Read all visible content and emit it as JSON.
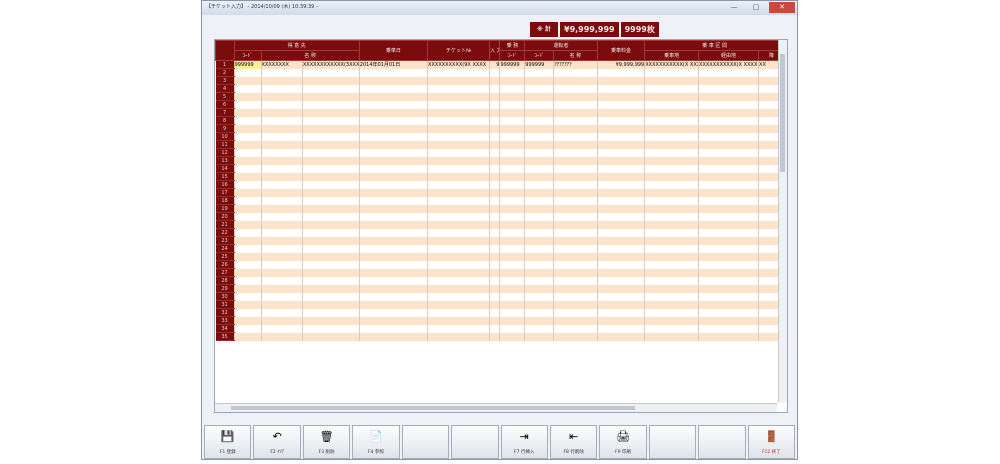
{
  "window": {
    "title": "【チケット入力】 - 2014/10/09 (木) 10:39:39 -",
    "controls": {
      "minimize": "—",
      "maximize": "□",
      "close": "✕"
    }
  },
  "totals": {
    "label": "※ 計",
    "amount": "¥9,999,999",
    "count": "9999枚"
  },
  "grid": {
    "group_headers": [
      "得 意 先",
      "乗車日",
      "チケット№",
      "入 力",
      "乗 務",
      "運転者",
      "乗車料金",
      "乗 車 区 間"
    ],
    "sub_headers": [
      "ｺｰﾄﾞ",
      "名 称",
      "ｺｰﾄﾞ",
      "ｺｰﾄﾞ",
      "名 称",
      "乗車地",
      "経由地",
      "降"
    ],
    "first_row": [
      "999999",
      "XXXXXXXX",
      "XXXXXXXXXXXX(3XXX",
      "2014年01月01日",
      "XXXXXXXXXX(9X XXXX",
      "9",
      "999999",
      "999999",
      "ｱｱｱｱｱｱｱ",
      "¥9,999,999",
      "XXXXXXXXXXX(X XXXX",
      "XXXXXXXXXXX(X XXXX",
      "XX"
    ],
    "row_count": 35
  },
  "toolbar": {
    "buttons": [
      {
        "key": "f1",
        "label": "F1 登録",
        "icon": "floppy-disk-icon",
        "glyph": "💾"
      },
      {
        "key": "f2",
        "label": "F2 ｸﾘｱ",
        "icon": "undo-arrow-icon",
        "glyph": "↶"
      },
      {
        "key": "f3",
        "label": "F3 削除",
        "icon": "trash-can-icon",
        "glyph": "🗑"
      },
      {
        "key": "f4",
        "label": "F4 参照",
        "icon": "document-icon",
        "glyph": "📄"
      },
      {
        "key": "f5",
        "label": "",
        "icon": "",
        "glyph": ""
      },
      {
        "key": "f6",
        "label": "",
        "icon": "",
        "glyph": ""
      },
      {
        "key": "f7",
        "label": "F7 行挿入",
        "icon": "insert-row-icon",
        "glyph": "⇥"
      },
      {
        "key": "f8",
        "label": "F8 行削除",
        "icon": "delete-row-icon",
        "glyph": "⇤"
      },
      {
        "key": "f9",
        "label": "F9 印刷",
        "icon": "printer-icon",
        "glyph": "🖨"
      },
      {
        "key": "f10",
        "label": "",
        "icon": "",
        "glyph": ""
      },
      {
        "key": "f11",
        "label": "",
        "icon": "",
        "glyph": ""
      },
      {
        "key": "f12",
        "label": "F12 終了",
        "icon": "exit-door-icon",
        "glyph": "🚪"
      }
    ]
  },
  "colors": {
    "header": "#7a0c0c",
    "row_alt": "#fbe4ca",
    "selected_cell": "#f9ee9a"
  }
}
